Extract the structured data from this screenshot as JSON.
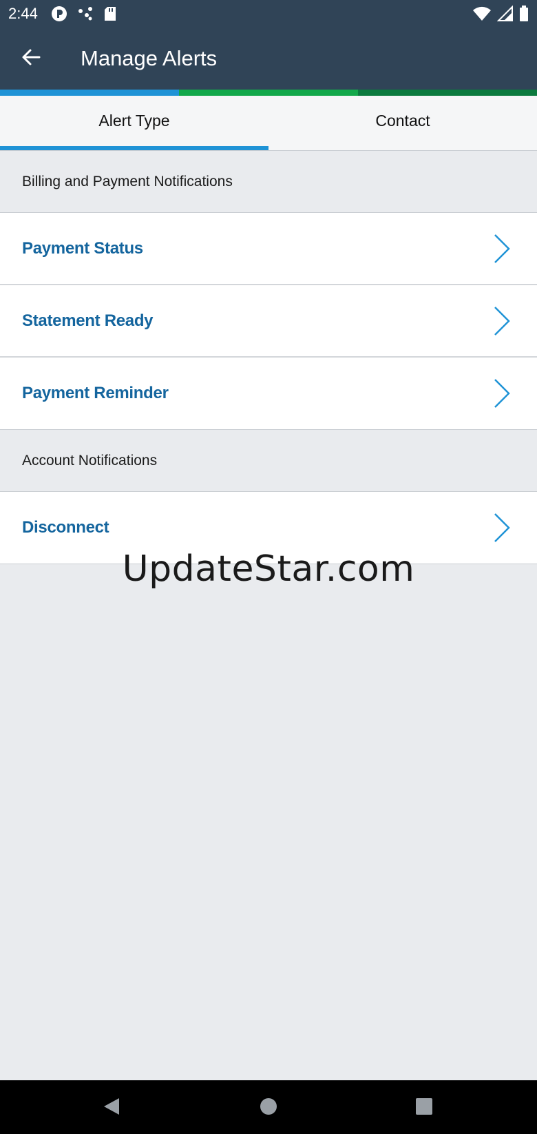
{
  "status_bar": {
    "time": "2:44",
    "left_icons": [
      "app-notification-icon",
      "connections-icon",
      "sd-card-icon"
    ],
    "right_icons": [
      "wifi-icon",
      "cell-signal-icon",
      "battery-icon"
    ]
  },
  "app_bar": {
    "title": "Manage Alerts",
    "back_icon": "arrow-left-icon"
  },
  "accent_colors": [
    "#1f93d6",
    "#12a84a",
    "#0b7a3e"
  ],
  "tabs": [
    {
      "label": "Alert Type",
      "active": true
    },
    {
      "label": "Contact",
      "active": false
    }
  ],
  "sections": [
    {
      "header": "Billing and Payment Notifications",
      "items": [
        {
          "label": "Payment Status"
        },
        {
          "label": "Statement Ready"
        },
        {
          "label": "Payment Reminder"
        }
      ]
    },
    {
      "header": "Account Notifications",
      "items": [
        {
          "label": "Disconnect"
        }
      ]
    }
  ],
  "watermark": "UpdateStar.com",
  "colors": {
    "header_bg": "#304457",
    "link_text": "#14659e",
    "chevron": "#1f93d6",
    "page_bg": "#e9ebee"
  },
  "nav_bar": {
    "buttons": [
      "back-triangle-icon",
      "home-circle-icon",
      "recents-square-icon"
    ]
  }
}
